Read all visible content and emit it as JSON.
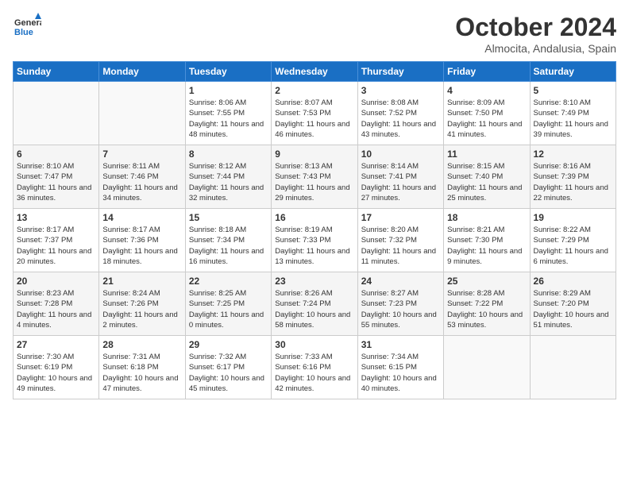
{
  "header": {
    "logo_line1": "General",
    "logo_line2": "Blue",
    "title": "October 2024",
    "location": "Almocita, Andalusia, Spain"
  },
  "weekdays": [
    "Sunday",
    "Monday",
    "Tuesday",
    "Wednesday",
    "Thursday",
    "Friday",
    "Saturday"
  ],
  "weeks": [
    [
      {
        "day": "",
        "info": ""
      },
      {
        "day": "",
        "info": ""
      },
      {
        "day": "1",
        "info": "Sunrise: 8:06 AM\nSunset: 7:55 PM\nDaylight: 11 hours and 48 minutes."
      },
      {
        "day": "2",
        "info": "Sunrise: 8:07 AM\nSunset: 7:53 PM\nDaylight: 11 hours and 46 minutes."
      },
      {
        "day": "3",
        "info": "Sunrise: 8:08 AM\nSunset: 7:52 PM\nDaylight: 11 hours and 43 minutes."
      },
      {
        "day": "4",
        "info": "Sunrise: 8:09 AM\nSunset: 7:50 PM\nDaylight: 11 hours and 41 minutes."
      },
      {
        "day": "5",
        "info": "Sunrise: 8:10 AM\nSunset: 7:49 PM\nDaylight: 11 hours and 39 minutes."
      }
    ],
    [
      {
        "day": "6",
        "info": "Sunrise: 8:10 AM\nSunset: 7:47 PM\nDaylight: 11 hours and 36 minutes."
      },
      {
        "day": "7",
        "info": "Sunrise: 8:11 AM\nSunset: 7:46 PM\nDaylight: 11 hours and 34 minutes."
      },
      {
        "day": "8",
        "info": "Sunrise: 8:12 AM\nSunset: 7:44 PM\nDaylight: 11 hours and 32 minutes."
      },
      {
        "day": "9",
        "info": "Sunrise: 8:13 AM\nSunset: 7:43 PM\nDaylight: 11 hours and 29 minutes."
      },
      {
        "day": "10",
        "info": "Sunrise: 8:14 AM\nSunset: 7:41 PM\nDaylight: 11 hours and 27 minutes."
      },
      {
        "day": "11",
        "info": "Sunrise: 8:15 AM\nSunset: 7:40 PM\nDaylight: 11 hours and 25 minutes."
      },
      {
        "day": "12",
        "info": "Sunrise: 8:16 AM\nSunset: 7:39 PM\nDaylight: 11 hours and 22 minutes."
      }
    ],
    [
      {
        "day": "13",
        "info": "Sunrise: 8:17 AM\nSunset: 7:37 PM\nDaylight: 11 hours and 20 minutes."
      },
      {
        "day": "14",
        "info": "Sunrise: 8:17 AM\nSunset: 7:36 PM\nDaylight: 11 hours and 18 minutes."
      },
      {
        "day": "15",
        "info": "Sunrise: 8:18 AM\nSunset: 7:34 PM\nDaylight: 11 hours and 16 minutes."
      },
      {
        "day": "16",
        "info": "Sunrise: 8:19 AM\nSunset: 7:33 PM\nDaylight: 11 hours and 13 minutes."
      },
      {
        "day": "17",
        "info": "Sunrise: 8:20 AM\nSunset: 7:32 PM\nDaylight: 11 hours and 11 minutes."
      },
      {
        "day": "18",
        "info": "Sunrise: 8:21 AM\nSunset: 7:30 PM\nDaylight: 11 hours and 9 minutes."
      },
      {
        "day": "19",
        "info": "Sunrise: 8:22 AM\nSunset: 7:29 PM\nDaylight: 11 hours and 6 minutes."
      }
    ],
    [
      {
        "day": "20",
        "info": "Sunrise: 8:23 AM\nSunset: 7:28 PM\nDaylight: 11 hours and 4 minutes."
      },
      {
        "day": "21",
        "info": "Sunrise: 8:24 AM\nSunset: 7:26 PM\nDaylight: 11 hours and 2 minutes."
      },
      {
        "day": "22",
        "info": "Sunrise: 8:25 AM\nSunset: 7:25 PM\nDaylight: 11 hours and 0 minutes."
      },
      {
        "day": "23",
        "info": "Sunrise: 8:26 AM\nSunset: 7:24 PM\nDaylight: 10 hours and 58 minutes."
      },
      {
        "day": "24",
        "info": "Sunrise: 8:27 AM\nSunset: 7:23 PM\nDaylight: 10 hours and 55 minutes."
      },
      {
        "day": "25",
        "info": "Sunrise: 8:28 AM\nSunset: 7:22 PM\nDaylight: 10 hours and 53 minutes."
      },
      {
        "day": "26",
        "info": "Sunrise: 8:29 AM\nSunset: 7:20 PM\nDaylight: 10 hours and 51 minutes."
      }
    ],
    [
      {
        "day": "27",
        "info": "Sunrise: 7:30 AM\nSunset: 6:19 PM\nDaylight: 10 hours and 49 minutes."
      },
      {
        "day": "28",
        "info": "Sunrise: 7:31 AM\nSunset: 6:18 PM\nDaylight: 10 hours and 47 minutes."
      },
      {
        "day": "29",
        "info": "Sunrise: 7:32 AM\nSunset: 6:17 PM\nDaylight: 10 hours and 45 minutes."
      },
      {
        "day": "30",
        "info": "Sunrise: 7:33 AM\nSunset: 6:16 PM\nDaylight: 10 hours and 42 minutes."
      },
      {
        "day": "31",
        "info": "Sunrise: 7:34 AM\nSunset: 6:15 PM\nDaylight: 10 hours and 40 minutes."
      },
      {
        "day": "",
        "info": ""
      },
      {
        "day": "",
        "info": ""
      }
    ]
  ]
}
